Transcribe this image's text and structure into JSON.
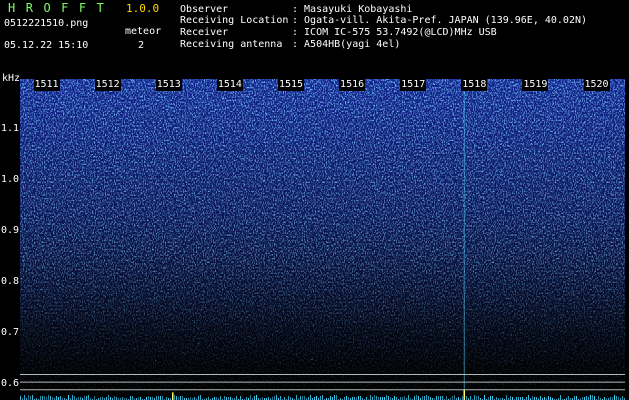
{
  "app": {
    "title": "HROFFT",
    "version": "1.0.0"
  },
  "capture": {
    "filename": "0512221510.png",
    "datetime": "05.12.22 15:10",
    "meteor_label": "meteor",
    "meteor_count": "2"
  },
  "info": [
    {
      "key": "Observer",
      "value": ": Masayuki Kobayashi"
    },
    {
      "key": "Receiving Location",
      "value": ": Ogata-vill. Akita-Pref. JAPAN (139.96E, 40.02N)"
    },
    {
      "key": "Receiver",
      "value": ": ICOM IC-575 53.7492(@LCD)MHz USB"
    },
    {
      "key": "Receiving antenna",
      "value": ": A504HB(yagi 4el)"
    }
  ],
  "colors": {
    "title_green": "#7cff63",
    "version_yellow": "#ffd900",
    "text_white": "#ffffff",
    "spectrogram_blue": "#1a3cff",
    "spectrogram_cyan": "#4fd6ff",
    "spectrogram_noise_blue": "#5aa8ff",
    "meteor_echo": "#ffff66",
    "reference_line": "#b8b8b8",
    "baseline_cyan": "#3fd8ff"
  },
  "chart_data": {
    "type": "heatmap",
    "ylabel": "kHz",
    "ylim": [
      0.57,
      1.2
    ],
    "y_ticks": [
      "1.1",
      "1.0",
      "0.9",
      "0.8",
      "0.7",
      "0.6"
    ],
    "y_tick_values": [
      1.1,
      1.0,
      0.9,
      0.8,
      0.7,
      0.6
    ],
    "x_ticks": [
      "1511",
      "1512",
      "1513",
      "1514",
      "1515",
      "1516",
      "1517",
      "1518",
      "1519",
      "1520"
    ],
    "x_tick_values": [
      1511,
      1512,
      1513,
      1514,
      1515,
      1516,
      1517,
      1518,
      1519,
      1520
    ],
    "xlim": [
      1510.55,
      1520.45
    ],
    "reference_lines_khz": [
      0.62,
      0.605,
      0.59
    ],
    "meteor_echoes": [
      {
        "minute": 1513.05,
        "khz_from": 0.545,
        "khz_to": 0.585
      },
      {
        "minute": 1517.82,
        "khz_from": 0.545,
        "khz_to": 0.59
      }
    ],
    "vertical_streak_minute": 1517.82,
    "grid": false,
    "legend": "none"
  }
}
